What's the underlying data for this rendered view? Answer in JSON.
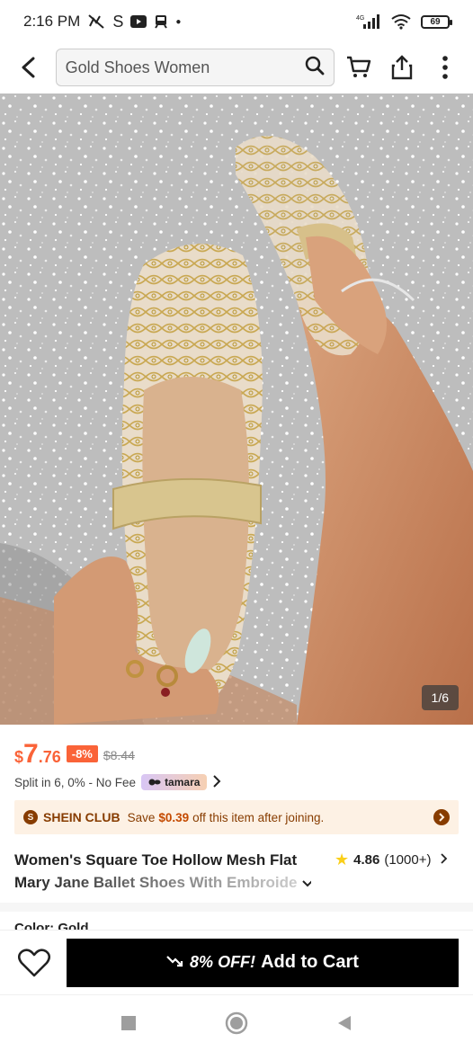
{
  "status_bar": {
    "time": "2:16 PM",
    "network": "4G",
    "battery": "69",
    "app_icon_s": "S"
  },
  "search": {
    "value": "Gold Shoes Women"
  },
  "icons": {
    "back": "back-arrow-icon",
    "search": "search-icon",
    "cart": "cart-icon",
    "share": "share-icon",
    "more": "more-vertical-icon",
    "wishlist": "heart-icon"
  },
  "gallery": {
    "counter": "1/6"
  },
  "price": {
    "currency": "$",
    "integer": "7",
    "decimal": ".76",
    "discount": "-8%",
    "original": "$8.44"
  },
  "installments": {
    "text": "Split in 6, 0% - No Fee",
    "provider": "tamara"
  },
  "club": {
    "badge": "S",
    "name": "SHEIN CLUB",
    "prefix": "Save",
    "amount": "$0.39",
    "suffix": "off this item after joining."
  },
  "product": {
    "title_line1": "Women's Square Toe Hollow Mesh Flat",
    "title_line2": "Mary Jane Ballet Shoes With Embroide",
    "rating": "4.86",
    "reviews": "(1000+)"
  },
  "attributes": {
    "color_label": "Color: Gold"
  },
  "actions": {
    "promo": "8% OFF!",
    "add_to_cart": "Add to Cart"
  },
  "colors": {
    "accent": "#fa6338",
    "club_bg": "#fdf1e4",
    "club_text": "#873c00",
    "star": "#facf19",
    "button": "#000000"
  }
}
